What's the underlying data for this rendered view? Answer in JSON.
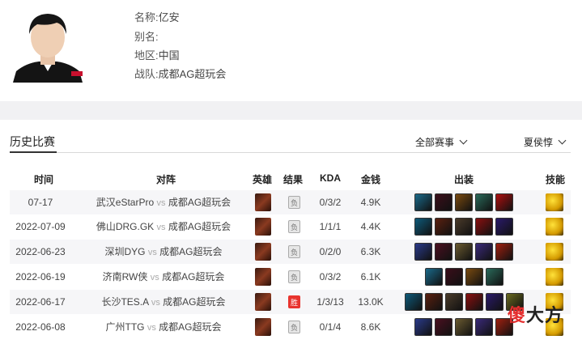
{
  "profile": {
    "fields": [
      {
        "label": "名称:",
        "value": "亿安"
      },
      {
        "label": "别名:",
        "value": ""
      },
      {
        "label": "地区:",
        "value": "中国"
      },
      {
        "label": "战队:",
        "value": "成都AG超玩会"
      }
    ]
  },
  "section": {
    "tab_label": "历史比赛",
    "filter_event": "全部赛事",
    "filter_hero": "夏侯惇"
  },
  "table": {
    "columns": [
      "时间",
      "对阵",
      "英雄",
      "结果",
      "KDA",
      "金钱",
      "出装",
      "技能"
    ],
    "vs_text": "vs",
    "rows": [
      {
        "date": "07-17",
        "team1": "武汉eStarPro",
        "team2": "成都AG超玩会",
        "result": "负",
        "win": false,
        "kda": "0/3/2",
        "gold": "4.9K",
        "items": 5
      },
      {
        "date": "2022-07-09",
        "team1": "佛山DRG.GK",
        "team2": "成都AG超玩会",
        "result": "负",
        "win": false,
        "kda": "1/1/1",
        "gold": "4.4K",
        "items": 5
      },
      {
        "date": "2022-06-23",
        "team1": "深圳DYG",
        "team2": "成都AG超玩会",
        "result": "负",
        "win": false,
        "kda": "0/2/0",
        "gold": "6.3K",
        "items": 5
      },
      {
        "date": "2022-06-19",
        "team1": "济南RW侠",
        "team2": "成都AG超玩会",
        "result": "负",
        "win": false,
        "kda": "0/3/2",
        "gold": "6.1K",
        "items": 4
      },
      {
        "date": "2022-06-17",
        "team1": "长沙TES.A",
        "team2": "成都AG超玩会",
        "result": "胜",
        "win": true,
        "kda": "1/3/13",
        "gold": "13.0K",
        "items": 6
      },
      {
        "date": "2022-06-08",
        "team1": "广州TTG",
        "team2": "成都AG超玩会",
        "result": "负",
        "win": false,
        "kda": "0/1/4",
        "gold": "8.6K",
        "items": 5
      }
    ]
  },
  "watermark": {
    "part1": "傻",
    "part2": "大方"
  }
}
